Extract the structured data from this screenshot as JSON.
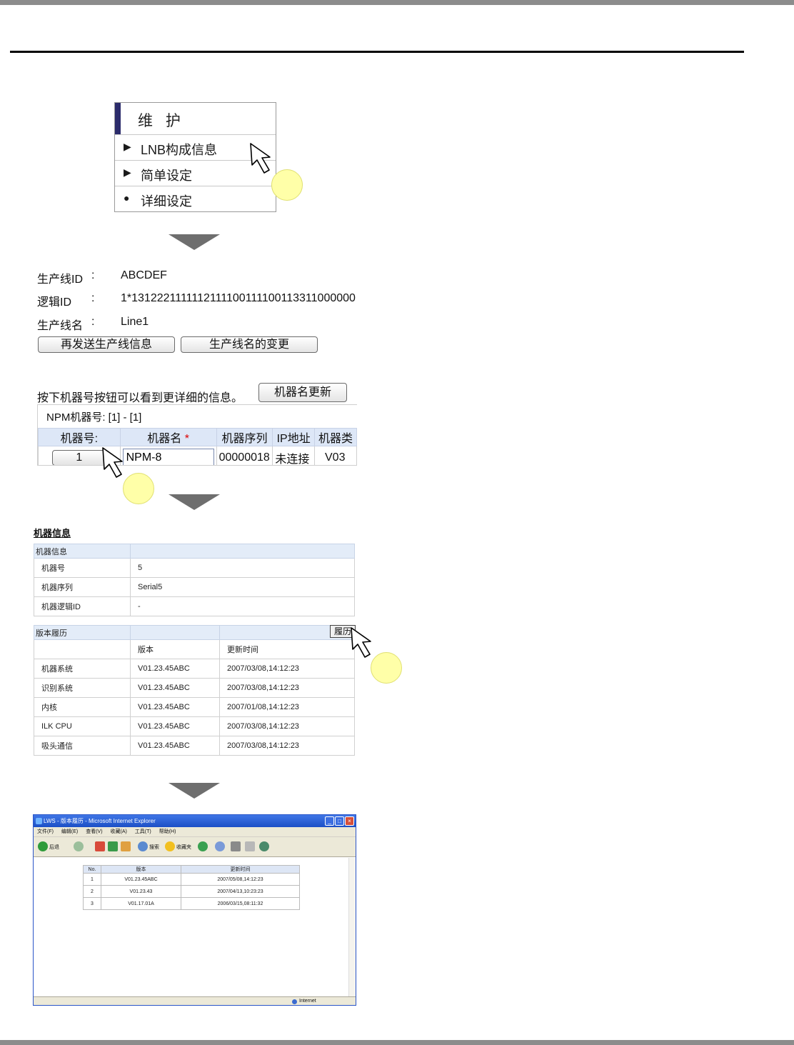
{
  "maintenance_menu": {
    "title": "维 护",
    "items": [
      {
        "bullet": "▶",
        "label": "LNB构成信息"
      },
      {
        "bullet": "▶",
        "label": "简单设定"
      },
      {
        "bullet": "●",
        "label": "详细设定"
      }
    ]
  },
  "line_info": {
    "line_id_label": "生产线ID",
    "line_id_sep": ":",
    "line_id_value": "ABCDEF",
    "logic_id_label": "逻辑ID",
    "logic_id_sep": ":",
    "logic_id_value": "1*1312221111112111100111100113311000000",
    "line_name_label": "生产线名",
    "line_name_sep": ":",
    "line_name_value": "Line1",
    "resend_button": "再发送生产线信息",
    "rename_button": "生产线名的变更"
  },
  "machine_list": {
    "hint": "按下机器号按钮可以看到更详细的信息。",
    "update_button": "机器名更新",
    "range_label": "NPM机器号: [1] - [1]",
    "columns": [
      "机器号:",
      "机器名",
      "机器序列",
      "IP地址",
      "机器类"
    ],
    "required_mark": "*",
    "row": {
      "number": "1",
      "name": "NPM-8",
      "serial": "00000018",
      "ip": "未连接",
      "type": "V03"
    }
  },
  "machine_info": {
    "title": "机器信息",
    "header": "机器信息",
    "rows": [
      {
        "label": "机器号",
        "value": "5"
      },
      {
        "label": "机器序列",
        "value": "Serial5"
      },
      {
        "label": "机器逻辑ID",
        "value": "-"
      }
    ]
  },
  "version_history": {
    "header": "版本履历",
    "history_button": "履历",
    "columns": [
      "",
      "版本",
      "更新时间"
    ],
    "rows": [
      {
        "name": "机器系统",
        "version": "V01.23.45ABC",
        "updated": "2007/03/08,14:12:23"
      },
      {
        "name": "识别系统",
        "version": "V01.23.45ABC",
        "updated": "2007/03/08,14:12:23"
      },
      {
        "name": "内核",
        "version": "V01.23.45ABC",
        "updated": "2007/01/08,14:12:23"
      },
      {
        "name": "ILK CPU",
        "version": "V01.23.45ABC",
        "updated": "2007/03/08,14:12:23"
      },
      {
        "name": "吸头通信",
        "version": "V01.23.45ABC",
        "updated": "2007/03/08,14:12:23"
      }
    ]
  },
  "ie_window": {
    "title": "LWS - 版本履历 - Microsoft Internet Explorer",
    "menu": [
      "文件(F)",
      "编辑(E)",
      "查看(V)",
      "收藏(A)",
      "工具(T)",
      "帮助(H)"
    ],
    "toolbar": {
      "back": "后退",
      "search": "搜索",
      "favorites": "收藏夹"
    },
    "status_zone": "Internet",
    "history_columns": [
      "No.",
      "版本",
      "更新时间"
    ],
    "history_rows": [
      {
        "no": "1",
        "version": "V01.23.45ABC",
        "updated": "2007/05/08,14:12:23"
      },
      {
        "no": "2",
        "version": "V01.23.43",
        "updated": "2007/04/13,10:23:23"
      },
      {
        "no": "3",
        "version": "V01.17.01A",
        "updated": "2006/03/15,08:11:32"
      }
    ]
  },
  "colors": {
    "step_circle": "#ffffa8",
    "menu_accent": "#2b2b6b",
    "table_header": "#dde7f7",
    "flow_arrow": "#6e6e6e",
    "ie_titlebar": "#1c4fc6"
  }
}
